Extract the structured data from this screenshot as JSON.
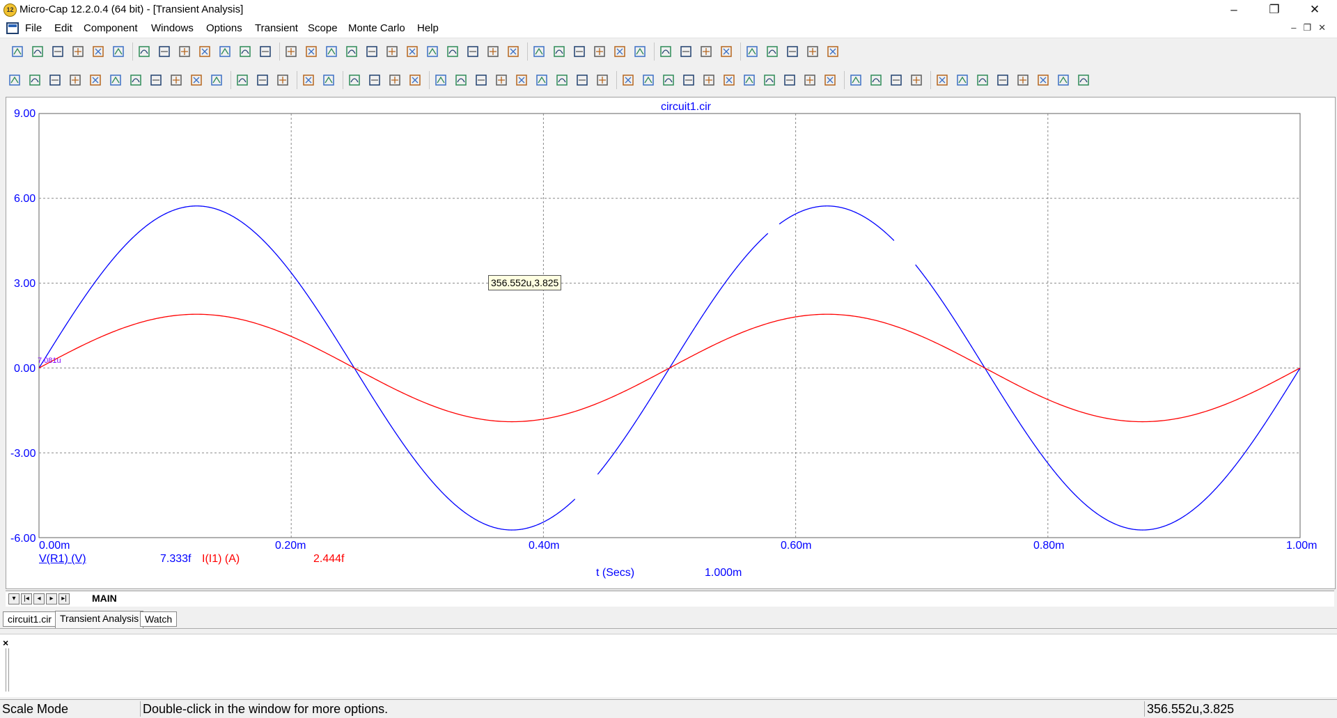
{
  "window": {
    "title": "Micro-Cap 12.2.0.4 (64 bit) - [Transient Analysis]",
    "app_icon_text": "12",
    "controls": [
      "–",
      "❐",
      "✕"
    ]
  },
  "menu": {
    "items": [
      {
        "label": "File"
      },
      {
        "label": "Edit"
      },
      {
        "label": "Component"
      },
      {
        "label": "Windows"
      },
      {
        "label": "Options"
      },
      {
        "label": "Transient"
      },
      {
        "label": "Scope"
      },
      {
        "label": "Monte Carlo"
      },
      {
        "label": "Help"
      }
    ],
    "mdi_controls": "–❐✕"
  },
  "toolbar1": {
    "icons": [
      "new-file-icon",
      "open-icon",
      "save-icon",
      "save-all-icon",
      "print-preview-icon",
      "print-icon",
      "undo-icon",
      "redo-icon",
      "cut-icon",
      "copy-icon",
      "paste-icon",
      "delete-icon",
      "select-all-icon",
      "ground-icon",
      "resistor-icon",
      "capacitor-icon",
      "inductor-icon",
      "diode-icon",
      "battery-icon",
      "transistor-icon",
      "opamp-icon",
      "source-icon",
      "switch-icon",
      "junction-icon",
      "probe-icon",
      "cascade-icon",
      "tile-vertical-icon",
      "tile-horizontal-icon",
      "restore-icon",
      "maximize-icon",
      "calculator-icon",
      "new-window-icon",
      "component-editor-icon",
      "globe-icon",
      "netlist-icon",
      "model-icon",
      "shape-editor-icon",
      "package-icon",
      "analysis-icon",
      "check-icon"
    ]
  },
  "toolbar2": {
    "icons": [
      "pointer-icon",
      "pan-icon",
      "zoom-mode-icon",
      "scale-icon",
      "cursor-mode-icon",
      "point-tag-icon",
      "horizontal-tag-icon",
      "vertical-tag-icon",
      "performance-tag-icon",
      "text-icon",
      "properties-icon",
      "run-icon",
      "stop-icon",
      "pause-icon",
      "add-curve-icon",
      "remove-curve-icon",
      "data-points-icon",
      "tokens-icon",
      "ruler-icon",
      "plus-mode-icon",
      "horizontal-axis-icon",
      "vertical-axis-icon",
      "separate-plots-icon",
      "grid-icon",
      "zoom-out-icon",
      "zoom-in-icon",
      "zoom-window-icon",
      "zoom-full-icon",
      "animate-icon",
      "peak-icon",
      "valley-icon",
      "high-icon",
      "low-icon",
      "inflection-icon",
      "global-high-icon",
      "global-low-icon",
      "slope-icon",
      "next-icon",
      "previous-icon",
      "clipboard-icon",
      "legend-icon",
      "bookmark-icon",
      "scale-x-icon",
      "scale-y-icon",
      "zoom-plus-icon",
      "zoom-minus-icon",
      "zoom-fit-icon",
      "layout-icon",
      "font-icon",
      "style-icon",
      "copy-plot-icon",
      "paste-plot-icon"
    ]
  },
  "plot": {
    "title": "circuit1.cir",
    "tooltip": "356.552u,3.825",
    "cursor_label": "7.081u",
    "y_ticks": [
      "9.00",
      "6.00",
      "3.00",
      "0.00",
      "-3.00",
      "-6.00"
    ],
    "x_ticks": [
      "0.00m",
      "0.20m",
      "0.40m",
      "0.60m",
      "0.80m",
      "1.00m"
    ],
    "legend": {
      "v_name": "V(R1) (V)",
      "v_value": "7.333f",
      "i_name": "I(I1) (A)",
      "i_value": "2.444f"
    },
    "x_axis_label": "t (Secs)",
    "x_axis_value": "1.000m",
    "colors": {
      "v": "#0000ff",
      "i": "#ff0000",
      "grid": "#888888",
      "axis": "#0000ff"
    }
  },
  "chart_data": {
    "type": "line",
    "title": "circuit1.cir",
    "xlabel": "t (Secs)",
    "xlim": [
      0,
      0.001
    ],
    "ylim": [
      -6,
      9
    ],
    "grid": true,
    "series": [
      {
        "name": "V(R1) (V)",
        "color": "#0000ff",
        "amplitude": 5.73,
        "frequency_hz": 2000,
        "x": [
          0,
          0.000125,
          0.00025,
          0.000375,
          0.0005,
          0.000625,
          0.00075,
          0.000875,
          0.001
        ],
        "y": [
          0,
          5.73,
          0,
          -5.73,
          0,
          5.73,
          0,
          -5.73,
          0
        ]
      },
      {
        "name": "I(I1) (A)",
        "color": "#ff0000",
        "amplitude": 1.9,
        "frequency_hz": 2000,
        "x": [
          0,
          0.000125,
          0.00025,
          0.000375,
          0.0005,
          0.000625,
          0.00075,
          0.000875,
          0.001
        ],
        "y": [
          0,
          1.9,
          0,
          -1.9,
          0,
          1.9,
          0,
          -1.9,
          0
        ]
      }
    ]
  },
  "sheet_tabs": {
    "main": "MAIN"
  },
  "doc_tabs": [
    {
      "label": "circuit1.cir"
    },
    {
      "label": "Transient Analysis"
    },
    {
      "label": "Watch"
    }
  ],
  "watch": {
    "close": "×"
  },
  "status": {
    "mode": "Scale Mode",
    "hint": "Double-click in the window for more options.",
    "coords": "356.552u,3.825"
  }
}
